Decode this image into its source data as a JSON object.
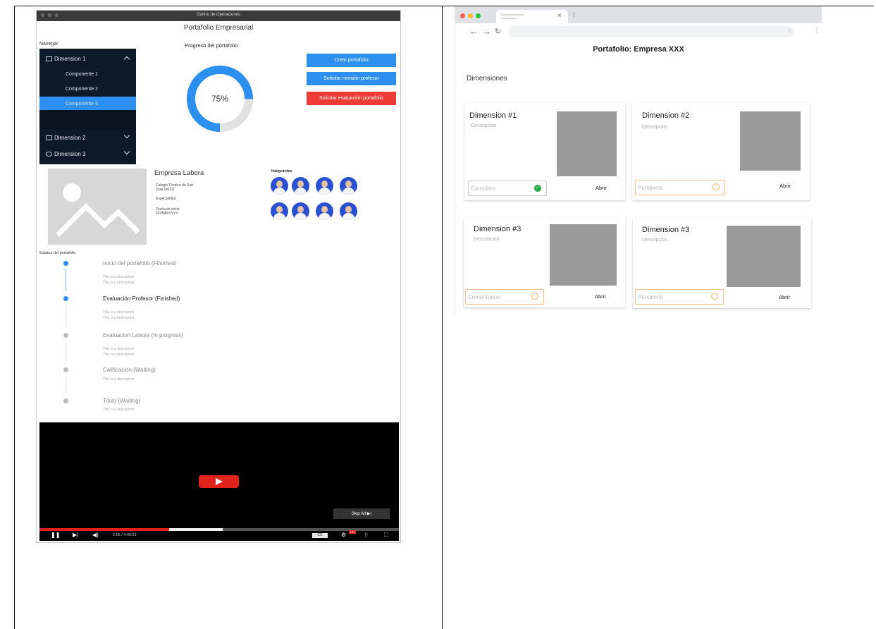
{
  "left_window": {
    "title": "Centro de Operaciones",
    "heading": "Portafolio Empresarial",
    "nav_label": "Navegar",
    "dimensions": [
      {
        "label": "Dimension 1",
        "icon": "mail-icon",
        "expanded": true,
        "components": [
          "Componente 1",
          "Componente 2",
          "Componente 3"
        ],
        "active_component": "Componente 3"
      },
      {
        "label": "Dimension 2",
        "icon": "grid-icon",
        "expanded": false
      },
      {
        "label": "Dimension 3",
        "icon": "gear-icon",
        "expanded": false
      }
    ],
    "progress": {
      "label": "Progreso del portafolio",
      "value_text": "75%",
      "fraction": 0.75,
      "color": "#2d8ff0",
      "track_color": "#e1e1e1"
    },
    "buttons": [
      {
        "label": "Crear portafolio",
        "color": "#2d8ff0"
      },
      {
        "label": "Solicitar revisión profesor",
        "color": "#2d8ff0"
      },
      {
        "label": "Solicitar evaluación portafolio",
        "color": "#ee3b34"
      }
    ],
    "company": {
      "name": "Empresa Labora",
      "school": "Colegio Técnico de San José (4012)",
      "specialty": "Especialidad",
      "start_label": "Fecha de inicio",
      "start_value": "DD/MM/YYYY"
    },
    "members_label": "Integrantes",
    "status_title": "Estatus del portafolio",
    "timeline": [
      {
        "title": "Inicio del portafolio (Finished)",
        "desc": [
          "This is a description",
          "This is a description"
        ],
        "state": "done"
      },
      {
        "title": "Evaluación Profesor (Finished)",
        "desc": [
          "This is a description",
          "This is a description"
        ],
        "state": "done"
      },
      {
        "title": "Evaluacion Labora (In progress)",
        "desc": [
          "This is a description",
          "This is a description"
        ],
        "state": "pending"
      },
      {
        "title": "Calificacion (Waiting)",
        "desc": [
          "This is a description"
        ],
        "state": "pending"
      },
      {
        "title": "Titulo (Waiting)",
        "desc": [
          "This is a description"
        ],
        "state": "pending"
      }
    ],
    "video": {
      "skip_label": "Skip Ad",
      "time": "2:05 / 4:45:21",
      "cc": "CC",
      "hd": "HD",
      "played_fraction": 0.36,
      "buffered_fraction": 0.51
    }
  },
  "browser": {
    "page_title": "Portafolio: Empresa XXX",
    "section_title": "Dimensiones",
    "cards": [
      {
        "title": "Dimension #1",
        "desc": "Descripcion",
        "status": "Completo",
        "status_type": "ok",
        "action": "Abrir"
      },
      {
        "title": "Dimension #2",
        "desc": "Descripcion",
        "status": "Pendiente",
        "status_type": "warn",
        "action": "Abrir"
      },
      {
        "title": "Dimension #3",
        "desc": "Descripcion",
        "status": "Comentarios",
        "status_type": "warn",
        "action": "Abrir"
      },
      {
        "title": "Dimension #3",
        "desc": "Descripcion",
        "status": "Pendiente",
        "status_type": "warn",
        "action": "Abrir"
      }
    ]
  }
}
